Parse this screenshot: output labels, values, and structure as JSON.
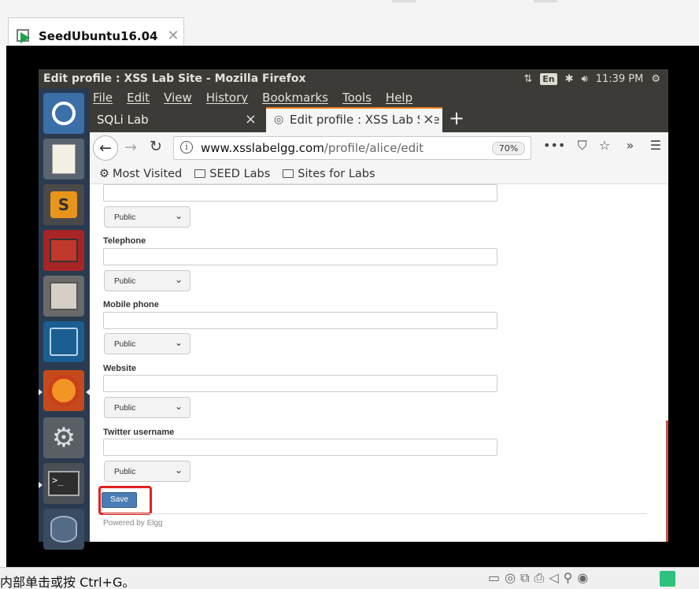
{
  "host": {
    "tab_title": "SeedUbuntu16.04",
    "tab_close": "✕",
    "status_message": "内部单击或按 Ctrl+G。"
  },
  "ubuntu": {
    "window_title": "Edit profile : XSS Lab Site - Mozilla Firefox",
    "keyboard": "En",
    "time": "11:39 PM"
  },
  "firefox": {
    "menu": [
      "File",
      "Edit",
      "View",
      "History",
      "Bookmarks",
      "Tools",
      "Help"
    ],
    "tabs": [
      {
        "label": "SQLi Lab",
        "active": false
      },
      {
        "label": "Edit profile : XSS Lab Site",
        "active": true
      }
    ],
    "url_host": "www.xsslabelgg.com",
    "url_path": "/profile/alice/edit",
    "zoom": "70%",
    "bookmarks": [
      "Most Visited",
      "SEED Labs",
      "Sites for Labs"
    ]
  },
  "page": {
    "fields": [
      {
        "label": "",
        "access": "Public"
      },
      {
        "label": "Telephone",
        "access": "Public"
      },
      {
        "label": "Mobile phone",
        "access": "Public"
      },
      {
        "label": "Website",
        "access": "Public"
      },
      {
        "label": "Twitter username",
        "access": "Public"
      }
    ],
    "save_label": "Save",
    "footer": "Powered by Elgg"
  }
}
